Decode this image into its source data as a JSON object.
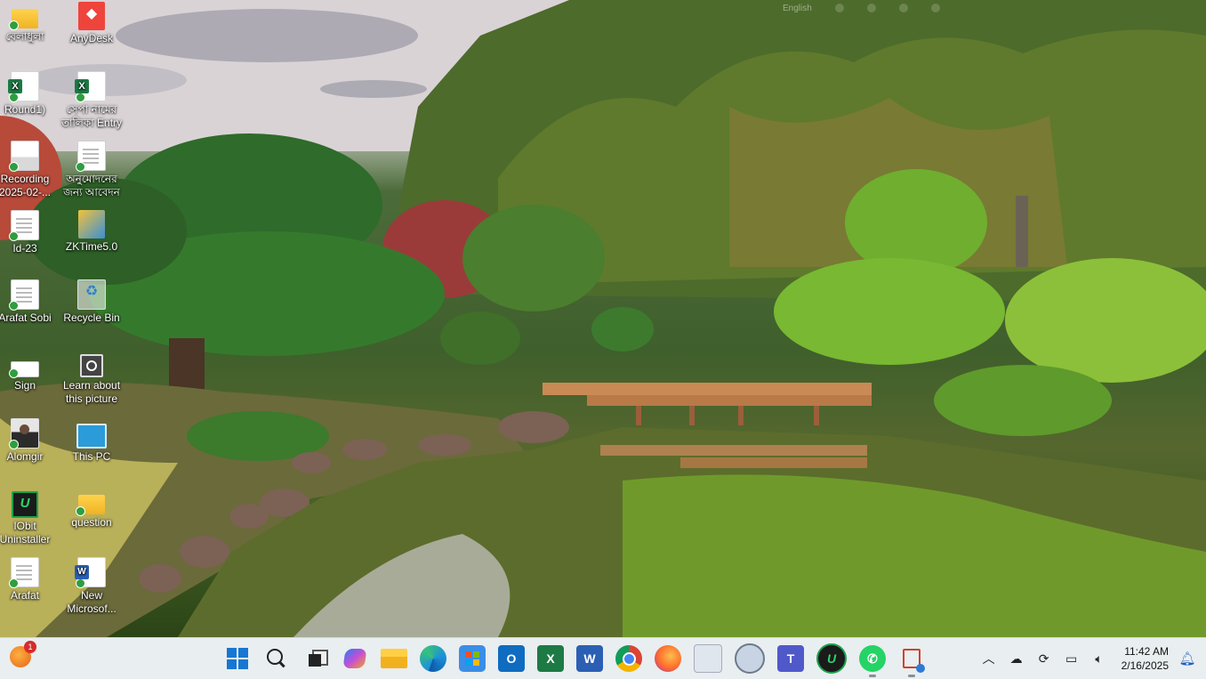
{
  "top_hint": {
    "language": "English"
  },
  "desktop_icons": [
    {
      "label": "বেলাধুলা",
      "icon": "folder-icon"
    },
    {
      "label": "AnyDesk",
      "icon": "anydesk-icon"
    },
    {
      "label": "Round1)",
      "icon": "excel-file-icon"
    },
    {
      "label": "সেপা নামের তালিকা Entry",
      "icon": "excel-file-icon"
    },
    {
      "label": "Recording 2025-02-...",
      "icon": "video-file-icon"
    },
    {
      "label": "অনুমোদনের জন্য আবেদন",
      "icon": "document-icon"
    },
    {
      "label": "Id-23",
      "icon": "document-icon"
    },
    {
      "label": "ZKTime5.0",
      "icon": "zktime-icon"
    },
    {
      "label": "Arafat Sobi",
      "icon": "document-icon"
    },
    {
      "label": "Recycle Bin",
      "icon": "recycle-bin-icon"
    },
    {
      "label": "Sign",
      "icon": "image-file-icon"
    },
    {
      "label": "Learn about this picture",
      "icon": "learn-picture-icon"
    },
    {
      "label": "Alomgir",
      "icon": "photo-icon"
    },
    {
      "label": "This PC",
      "icon": "this-pc-icon"
    },
    {
      "label": "IObit Uninstaller",
      "icon": "iobit-icon"
    },
    {
      "label": "question",
      "icon": "folder-icon"
    },
    {
      "label": "Arafat",
      "icon": "document-icon"
    },
    {
      "label": "New Microsof...",
      "icon": "word-file-icon"
    }
  ],
  "taskbar": {
    "notification_badge": "1",
    "apps": [
      "windows-start-icon",
      "search-icon",
      "task-view-icon",
      "copilot-icon",
      "file-explorer-icon",
      "edge-icon",
      "store-icon",
      "outlook-icon",
      "excel-icon",
      "word-icon",
      "chrome-icon",
      "firefox-icon",
      "screenshot-tool-icon",
      "remote-desktop-icon",
      "teams-icon",
      "iobit-icon",
      "whatsapp-icon",
      "snipping-tool-icon"
    ],
    "clock": {
      "time": "11:42 AM",
      "date": "2/16/2025"
    },
    "colors": {
      "taskbar_bg": "#e9eef0",
      "accent": "#1877d2"
    }
  }
}
